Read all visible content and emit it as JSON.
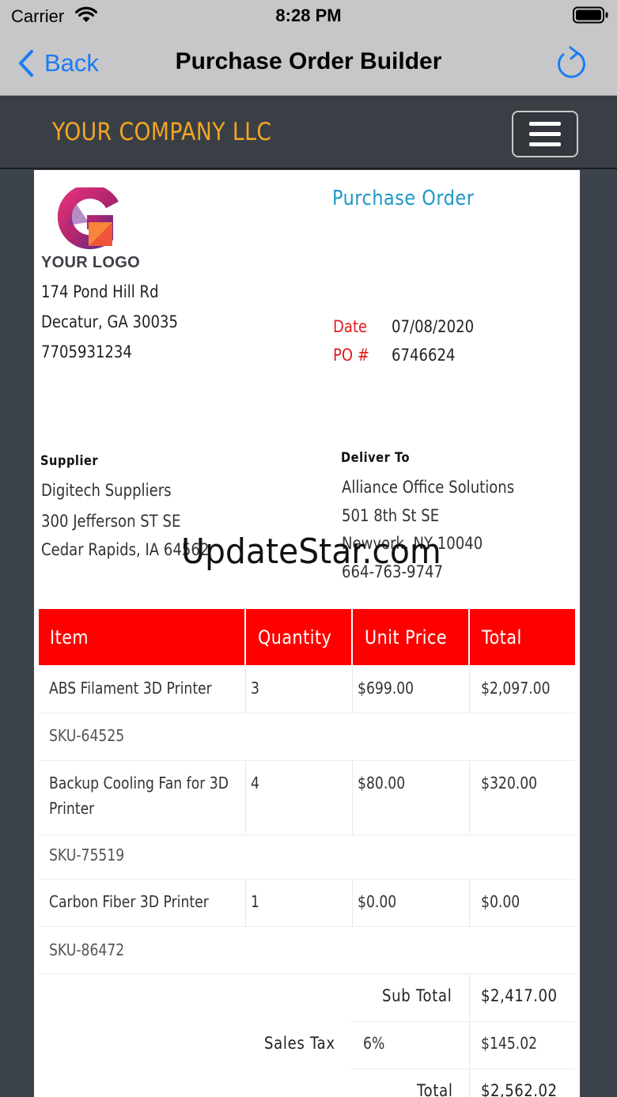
{
  "status_bar": {
    "carrier": "Carrier",
    "time": "8:28 PM"
  },
  "nav": {
    "back_label": "Back",
    "title": "Purchase Order Builder"
  },
  "header": {
    "company_name": "YOUR COMPANY LLC"
  },
  "logo": {
    "text": "YOUR LOGO"
  },
  "document": {
    "title": "Purchase Order",
    "company_address": [
      "174 Pond Hill Rd",
      "Decatur, GA 30035",
      "7705931234"
    ],
    "date_label": "Date",
    "date_value": "07/08/2020",
    "po_label": "PO #",
    "po_value": "6746624",
    "supplier": {
      "heading": "Supplier",
      "lines": [
        "Digitech Suppliers",
        "300 Jefferson ST SE",
        "Cedar Rapids, IA 64562"
      ]
    },
    "deliver_to": {
      "heading": "Deliver To",
      "lines": [
        "Alliance Office Solutions",
        "501 8th St SE",
        "Newyork, NY 10040",
        "664-763-9747"
      ]
    }
  },
  "watermark": "UpdateStar.com",
  "table": {
    "headers": [
      "Item",
      "Quantity",
      "Unit Price",
      "Total"
    ],
    "rows": [
      {
        "item": "ABS Filament 3D Printer",
        "quantity": "3",
        "unit_price": "$699.00",
        "total": "$2,097.00",
        "sku": "SKU-64525"
      },
      {
        "item": "Backup Cooling Fan for 3D",
        "item_cont": "Printer",
        "quantity": "4",
        "unit_price": "$80.00",
        "total": "$320.00",
        "sku": "SKU-75519"
      },
      {
        "item": "Carbon Fiber 3D Printer",
        "quantity": "1",
        "unit_price": "$0.00",
        "total": "$0.00",
        "sku": "SKU-86472"
      }
    ]
  },
  "totals": {
    "subtotal_label": "Sub Total",
    "subtotal_value": "$2,417.00",
    "tax_label": "Sales Tax",
    "tax_rate": "6%",
    "tax_value": "$145.02",
    "total_label": "Total",
    "total_value": "$2,562.02"
  },
  "colors": {
    "accent_orange": "#f4a521",
    "ios_blue": "#1a7cf3",
    "table_header_red": "#ff0000",
    "doc_title_blue": "#1e98c9"
  }
}
